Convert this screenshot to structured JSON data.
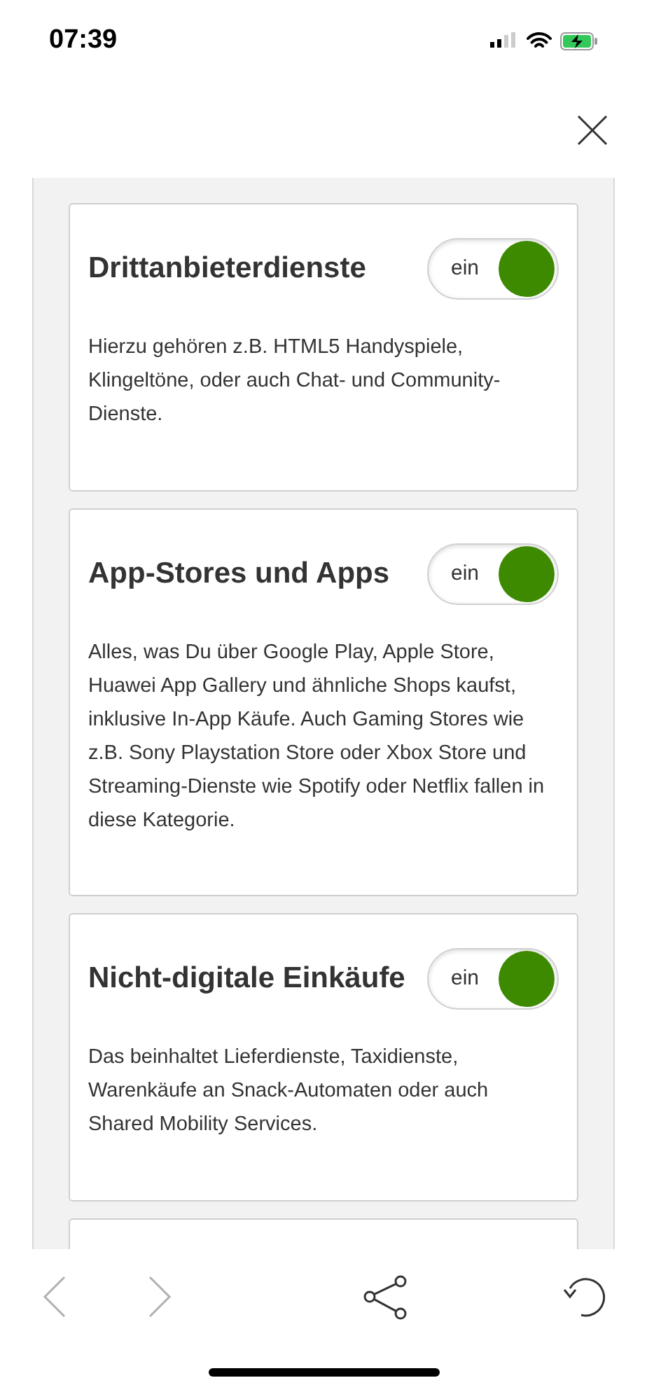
{
  "status_bar": {
    "time": "07:39"
  },
  "cards": [
    {
      "title": "Drittanbieterdienste",
      "toggle": {
        "label": "ein",
        "on": true
      },
      "text": "Hierzu gehören z.B. HTML5 Handyspiele, Klingeltöne, oder auch Chat- und Community-Dienste."
    },
    {
      "title": "App-Stores und Apps",
      "toggle": {
        "label": "ein",
        "on": true
      },
      "text": "Alles, was Du über Google Play, Apple Store, Huawei App Gallery und ähnliche Shops kaufst, inklusive In-App Käufe. Auch Gaming Stores wie z.B. Sony Playstation Store oder Xbox Store und Streaming-Dienste wie Spotify oder Netflix fallen in diese Kategorie."
    },
    {
      "title": "Nicht-digitale Einkäufe",
      "toggle": {
        "label": "ein",
        "on": true
      },
      "text": "Das beinhaltet Lieferdienste, Taxidienste, Warenkäufe an Snack-Automaten oder auch Shared Mobility Services."
    }
  ],
  "toolbar": {
    "back": {
      "disabled": true
    },
    "forward": {
      "disabled": true
    }
  }
}
